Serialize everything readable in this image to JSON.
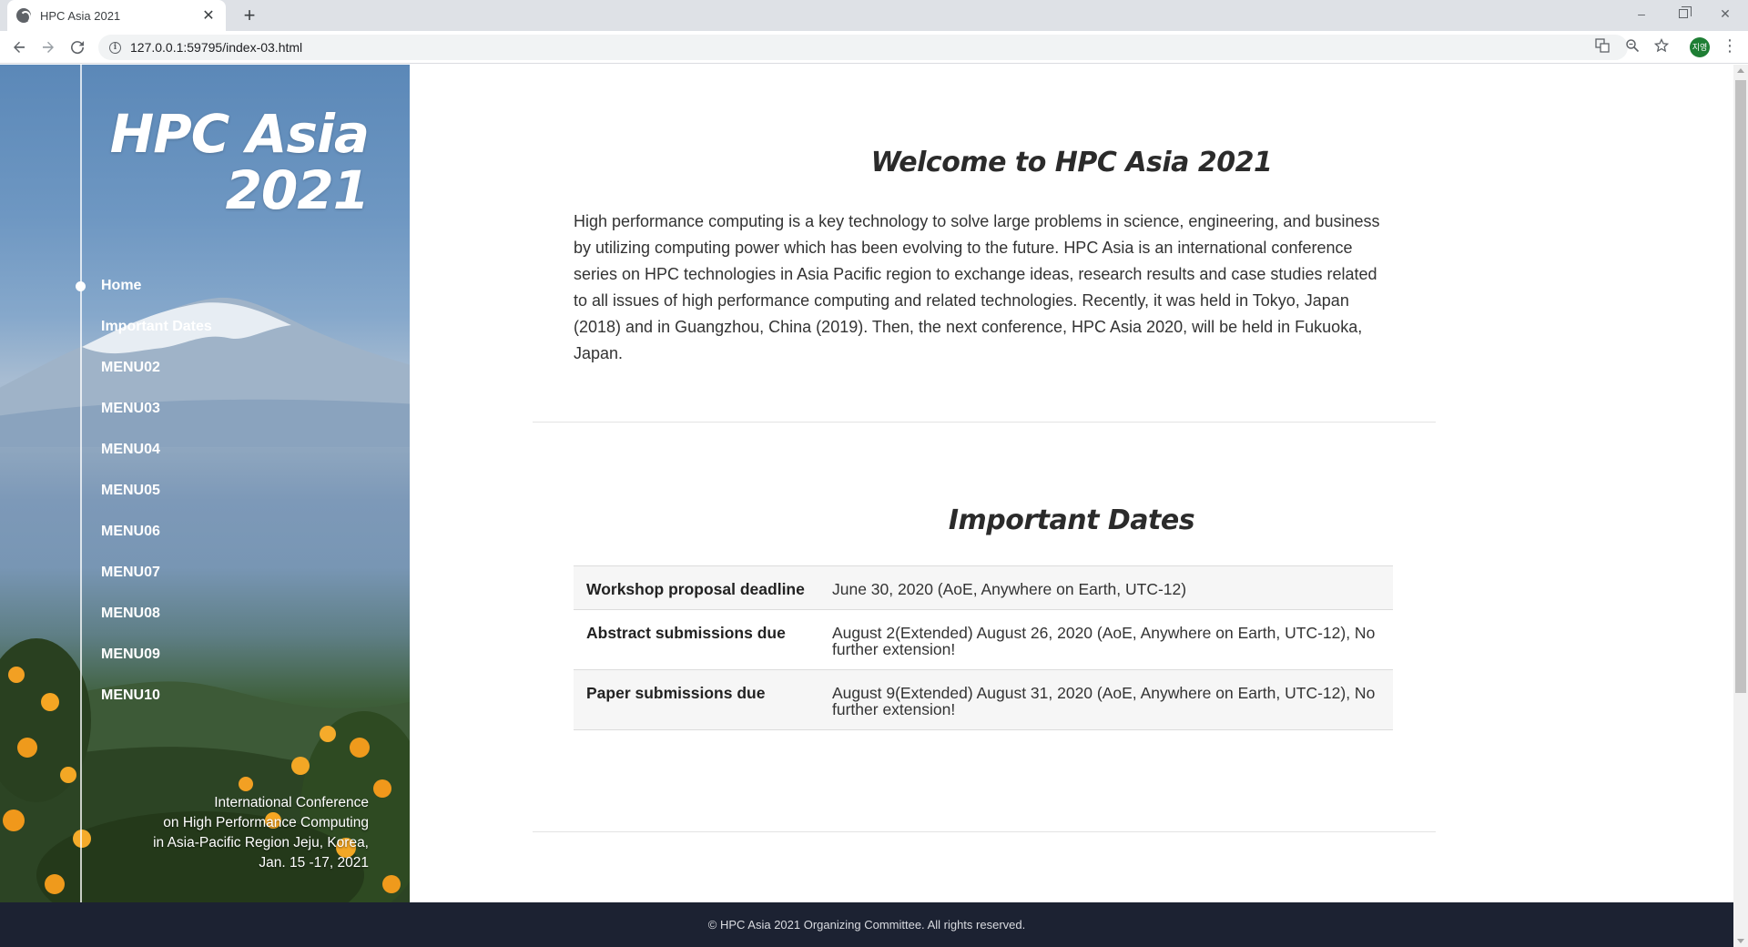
{
  "browser": {
    "tab_title": "HPC Asia 2021",
    "new_tab": "+",
    "url": "127.0.0.1:59795/index-03.html",
    "profile_initials": "지영",
    "window_min": "–",
    "window_close": "✕"
  },
  "sidebar": {
    "brand_line1": "HPC Asia",
    "brand_line2": "2021",
    "nav": [
      {
        "label": "Home",
        "active": true
      },
      {
        "label": "Important Dates"
      },
      {
        "label": "MENU02"
      },
      {
        "label": "MENU03"
      },
      {
        "label": "MENU04"
      },
      {
        "label": "MENU05"
      },
      {
        "label": "MENU06"
      },
      {
        "label": "MENU07"
      },
      {
        "label": "MENU08"
      },
      {
        "label": "MENU09"
      },
      {
        "label": "MENU10"
      }
    ],
    "conference_info": [
      "International Conference",
      "on High Performance Computing",
      "in Asia-Pacific Region Jeju, Korea,",
      "Jan. 15 -17, 2021"
    ]
  },
  "main": {
    "welcome_title": "Welcome to HPC Asia 2021",
    "intro_text": "High performance computing is a key technology to solve large problems in science, engineering, and business by utilizing computing power which has been evolving to the future. HPC Asia is an international conference series on HPC technologies in Asia Pacific region to exchange ideas, research results and case studies related to all issues of high performance computing and related technologies. Recently, it was held in Tokyo, Japan (2018) and in Guangzhou, China (2019). Then, the next conference, HPC Asia 2020, will be held in Fukuoka, Japan.",
    "dates_title": "Important Dates",
    "dates": [
      {
        "label": "Workshop proposal deadline",
        "value": "June 30, 2020 (AoE, Anywhere on Earth, UTC-12)"
      },
      {
        "label": "Abstract submissions due",
        "value": "August 2(Extended) August 26, 2020 (AoE, Anywhere on Earth, UTC-12), No further extension!"
      },
      {
        "label": "Paper submissions due",
        "value": "August 9(Extended) August 31, 2020 (AoE, Anywhere on Earth, UTC-12), No further extension!"
      }
    ]
  },
  "footer": {
    "copyright": "© HPC Asia 2021 Organizing Committee. All rights reserved."
  },
  "colors": {
    "footer_bg": "#1c2232",
    "sidebar_sky": "#5b88b8",
    "heading": "#2b2b2b"
  }
}
